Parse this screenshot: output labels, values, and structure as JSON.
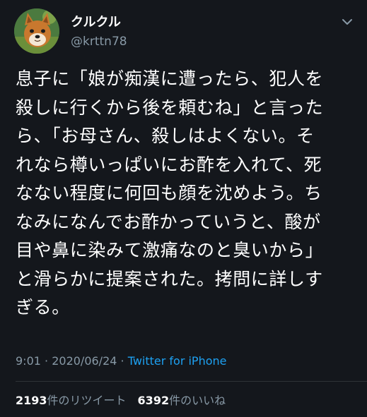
{
  "tweet": {
    "display_name": "クルクル",
    "handle": "@krttn78",
    "avatar_icon": "shiba-dog-avatar",
    "menu_icon": "chevron-down-icon",
    "lines": [
      "息子に「娘が痴漢に遭ったら、犯人を",
      "殺しに行くから後を頼むね」と言った",
      "ら、「お母さん、殺しはよくない。そ",
      "れなら樽いっぱいにお酢を入れて、死",
      "なない程度に何回も顔を沈めよう。ち",
      "なみになんでお酢かっていうと、酸が",
      "目や鼻に染みて激痛なのと臭いから」",
      "と滑らかに提案された。拷問に詳しす",
      "ぎる。"
    ],
    "time": "9:01",
    "separator": " · ",
    "date": "2020/06/24",
    "source": "Twitter for iPhone",
    "retweet_count": "2193",
    "retweet_label": "件のリツイート",
    "like_count": "6392",
    "like_label": "件のいいね"
  },
  "colors": {
    "background": "#14171c",
    "text": "#ffffff",
    "secondary": "#8899a6",
    "link": "#1da1f2"
  }
}
